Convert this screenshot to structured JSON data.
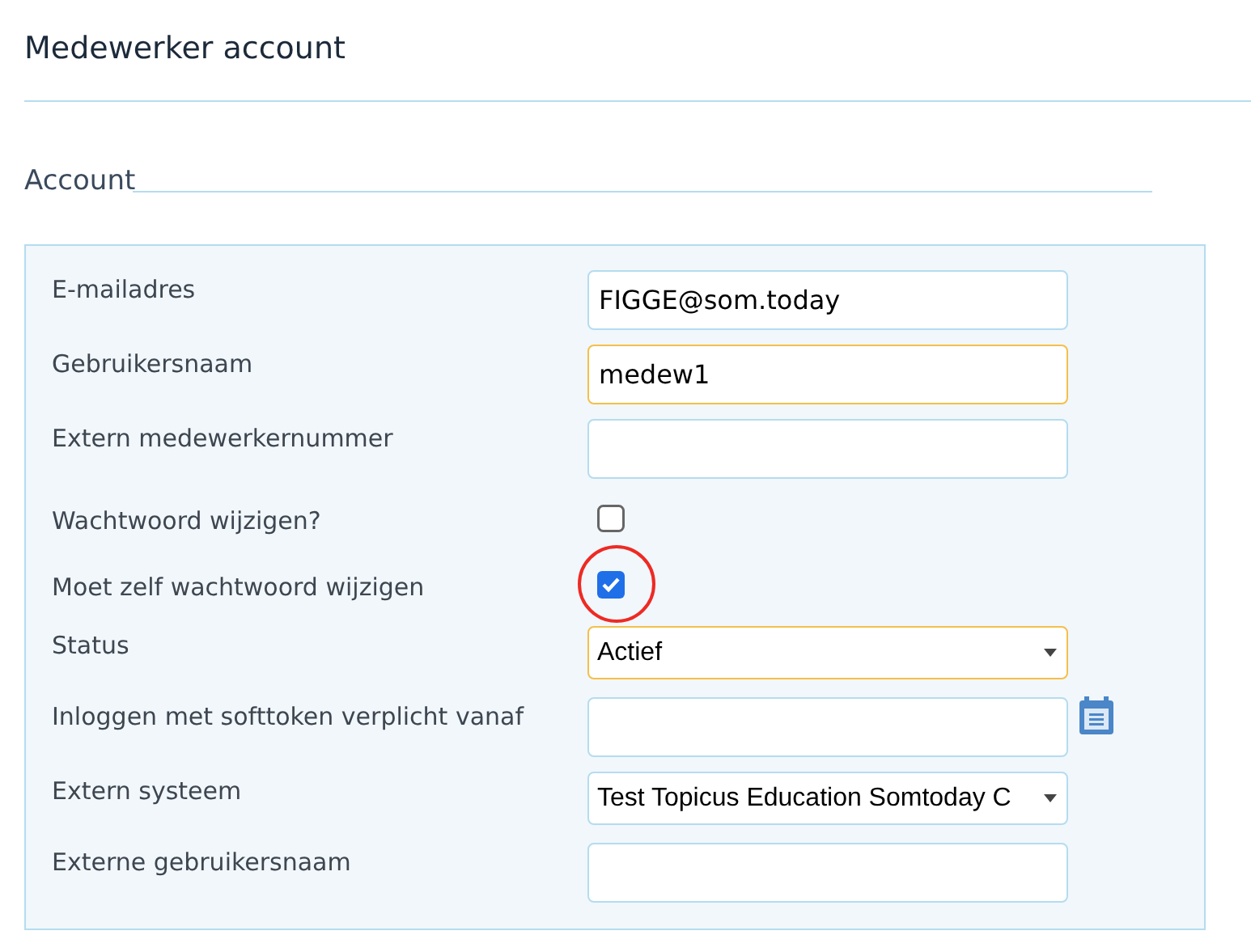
{
  "page_title": "Medewerker account",
  "section": {
    "legend": "Account"
  },
  "fields": [
    {
      "label": "E-mailadres",
      "kind": "text",
      "value": "FIGGE@som.today",
      "highlighted": false
    },
    {
      "label": "Gebruikersnaam",
      "kind": "text",
      "value": "medew1",
      "highlighted": true
    },
    {
      "label": "Extern medewerkernummer",
      "kind": "text",
      "highlighted": false
    },
    {
      "label": "Wachtwoord wijzigen?",
      "kind": "checkbox",
      "checked": false,
      "annotated": false
    },
    {
      "label": "Moet zelf wachtwoord wijzigen",
      "kind": "checkbox",
      "checked": true,
      "annotated": true
    },
    {
      "label": "Status",
      "kind": "select",
      "value": "Actief",
      "highlighted": true
    },
    {
      "label": "Inloggen met softtoken verplicht vanaf",
      "kind": "date",
      "highlighted": false
    },
    {
      "label": "Extern systeem",
      "kind": "select",
      "value": "Test Topicus Education Somtoday C",
      "highlighted": false
    },
    {
      "label": "Externe gebruikersnaam",
      "kind": "text",
      "highlighted": false
    }
  ]
}
